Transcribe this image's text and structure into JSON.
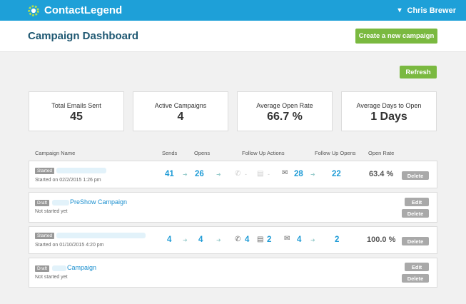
{
  "brand": {
    "name": "ContactLegend"
  },
  "user": {
    "name": "Chris Brewer"
  },
  "page": {
    "title": "Campaign Dashboard",
    "create_label": "Create a new campaign",
    "refresh_label": "Refresh"
  },
  "stats": [
    {
      "label": "Total Emails Sent",
      "value": "45"
    },
    {
      "label": "Active Campaigns",
      "value": "4"
    },
    {
      "label": "Average Open Rate",
      "value": "66.7 %"
    },
    {
      "label": "Average Days to Open",
      "value": "1 Days"
    }
  ],
  "columns": {
    "name": "Campaign Name",
    "sends": "Sends",
    "opens": "Opens",
    "followup_actions": "Follow Up Actions",
    "followup_opens": "Follow Up Opens",
    "open_rate": "Open Rate"
  },
  "campaigns": [
    {
      "status": "Started",
      "subtitle": "Started on 02/2/2015 1:26 pm",
      "sends": "41",
      "opens": "26",
      "calls": "-",
      "docs": "-",
      "emails": "28",
      "followup_opens": "22",
      "open_rate": "63.4 %",
      "delete": "Delete"
    },
    {
      "status": "Draft",
      "name": "PreShow Campaign",
      "subtitle": "Not started yet",
      "edit": "Edit",
      "delete": "Delete"
    },
    {
      "status": "Started",
      "subtitle": "Started on 01/10/2015 4:20 pm",
      "sends": "4",
      "opens": "4",
      "calls": "4",
      "docs": "2",
      "emails": "4",
      "followup_opens": "2",
      "open_rate": "100.0 %",
      "delete": "Delete"
    },
    {
      "status": "Draft",
      "name": "Campaign",
      "subtitle": "Not started yet",
      "edit": "Edit",
      "delete": "Delete"
    }
  ],
  "colors": {
    "topbar": "#1ea0d8",
    "accent_green": "#7ab940",
    "link_blue": "#1a8fcf"
  }
}
